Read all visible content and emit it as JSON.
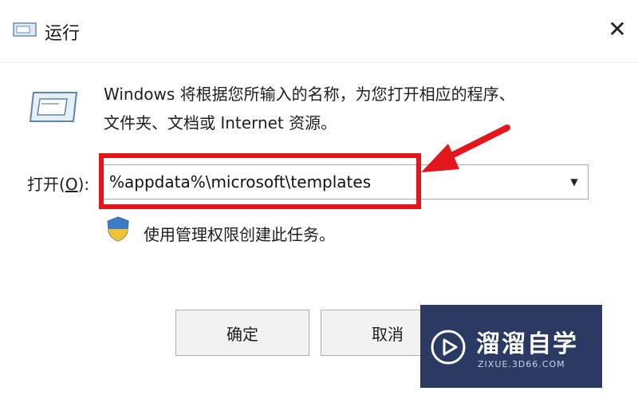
{
  "window": {
    "title": "运行",
    "close_glyph": "✕"
  },
  "dialog": {
    "description_line1": "Windows 将根据您所输入的名称，为您打开相应的程序、",
    "description_line2": "文件夹、文档或 Internet 资源。",
    "open_label_prefix": "打开(",
    "open_label_accel": "O",
    "open_label_suffix": "):",
    "open_value": "%appdata%\\microsoft\\templates",
    "admin_text": "使用管理权限创建此任务。",
    "ok_label": "确定",
    "cancel_label": "取消"
  },
  "watermark": {
    "title": "溜溜自学",
    "url": "ZIXUE.3D66.COM"
  },
  "colors": {
    "highlight": "#e2161b",
    "watermark_bg": "#2a3a63"
  },
  "icons": [
    "run-app-icon",
    "close-icon",
    "run-icon",
    "chevron-down-icon",
    "shield-icon",
    "arrow-icon",
    "play-logo-icon"
  ]
}
